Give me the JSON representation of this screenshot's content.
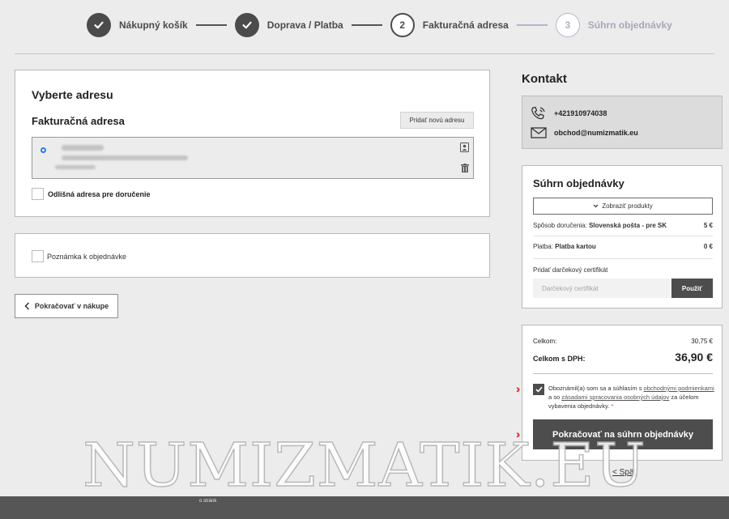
{
  "stepper": {
    "steps": [
      {
        "label": "Nákupný košík",
        "state": "done",
        "icon": "check-icon"
      },
      {
        "label": "Doprava / Platba",
        "state": "done",
        "icon": "check-icon"
      },
      {
        "label": "Fakturačná adresa",
        "state": "current",
        "number": "2"
      },
      {
        "label": "Súhrn objednávky",
        "state": "future",
        "number": "3"
      }
    ]
  },
  "address": {
    "title": "Vyberte adresu",
    "subtitle": "Fakturačná adresa",
    "new_address_label": "Pridať novú adresu",
    "different_delivery_label": "Odlišná adresa pre doručenie"
  },
  "note": {
    "label": "Poznámka k objednávke"
  },
  "back_button": {
    "label": "Pokračovať v nákupe"
  },
  "contact": {
    "title": "Kontakt",
    "phone": "+421910974038",
    "email": "obchod@numizmatik.eu"
  },
  "summary": {
    "title": "Súhrn objednávky",
    "show_products_label": "Zobraziť produkty",
    "delivery_label": "Spôsob doručenia:",
    "delivery_value": "Slovenská pošta - pre SK",
    "delivery_price": "5 €",
    "payment_label": "Platba:",
    "payment_value": "Platba kartou",
    "payment_price": "0 €",
    "certificate_label": "Pridať darčekový certifikát",
    "certificate_placeholder": "Darčekový certifikát",
    "certificate_button": "Použiť"
  },
  "totals": {
    "total_label": "Celkom:",
    "total_value": "30,75 €",
    "total_vat_label": "Celkom s DPH:",
    "total_vat_value": "36,90 €",
    "terms_part1": "Oboznámil(a) som sa a súhlasím s ",
    "terms_link1": "obchodnými podmienkami",
    "terms_part2": " a so ",
    "terms_link2": "zásadami spracovania osobných údajov",
    "terms_part3": " za účelom vybavenia objednávky. ",
    "terms_required": "*",
    "continue_button": "Pokračovať na súhrn objednávky"
  },
  "back_link": "< Späť",
  "footer_text": "o stránk",
  "watermark": "NUMIZMATIK.EU",
  "colors": {
    "accent_dark": "#4d4d4d",
    "radio_blue": "#2a7be0",
    "marker_red": "#e03020"
  }
}
